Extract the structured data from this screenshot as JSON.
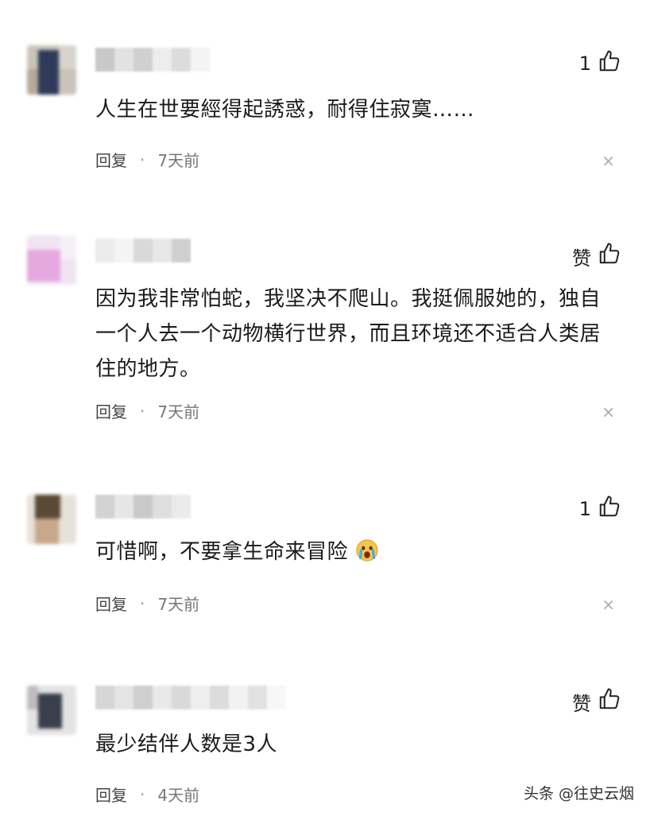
{
  "comments": [
    {
      "like_label": "1",
      "text": "人生在世要經得起誘惑，耐得住寂寞……",
      "reply_label": "回复",
      "separator": "·",
      "time": "7天前",
      "close_symbol": "×"
    },
    {
      "like_label": "赞",
      "text": "因为我非常怕蛇，我坚决不爬山。我挺佩服她的，独自一个人去一个动物横行世界，而且环境还不适合人类居住的地方。",
      "reply_label": "回复",
      "separator": "·",
      "time": "7天前",
      "close_symbol": "×"
    },
    {
      "like_label": "1",
      "text": "可惜啊，不要拿生命来冒险",
      "emoji": "crying-face-emoji",
      "reply_label": "回复",
      "separator": "·",
      "time": "7天前",
      "close_symbol": "×"
    },
    {
      "like_label": "赞",
      "text": "最少结伴人数是3人",
      "reply_label": "回复",
      "separator": "·",
      "time": "4天前"
    }
  ],
  "watermark": "头条 @往史云烟",
  "icons": {
    "like": "thumbs-up-icon",
    "close": "close-icon"
  }
}
